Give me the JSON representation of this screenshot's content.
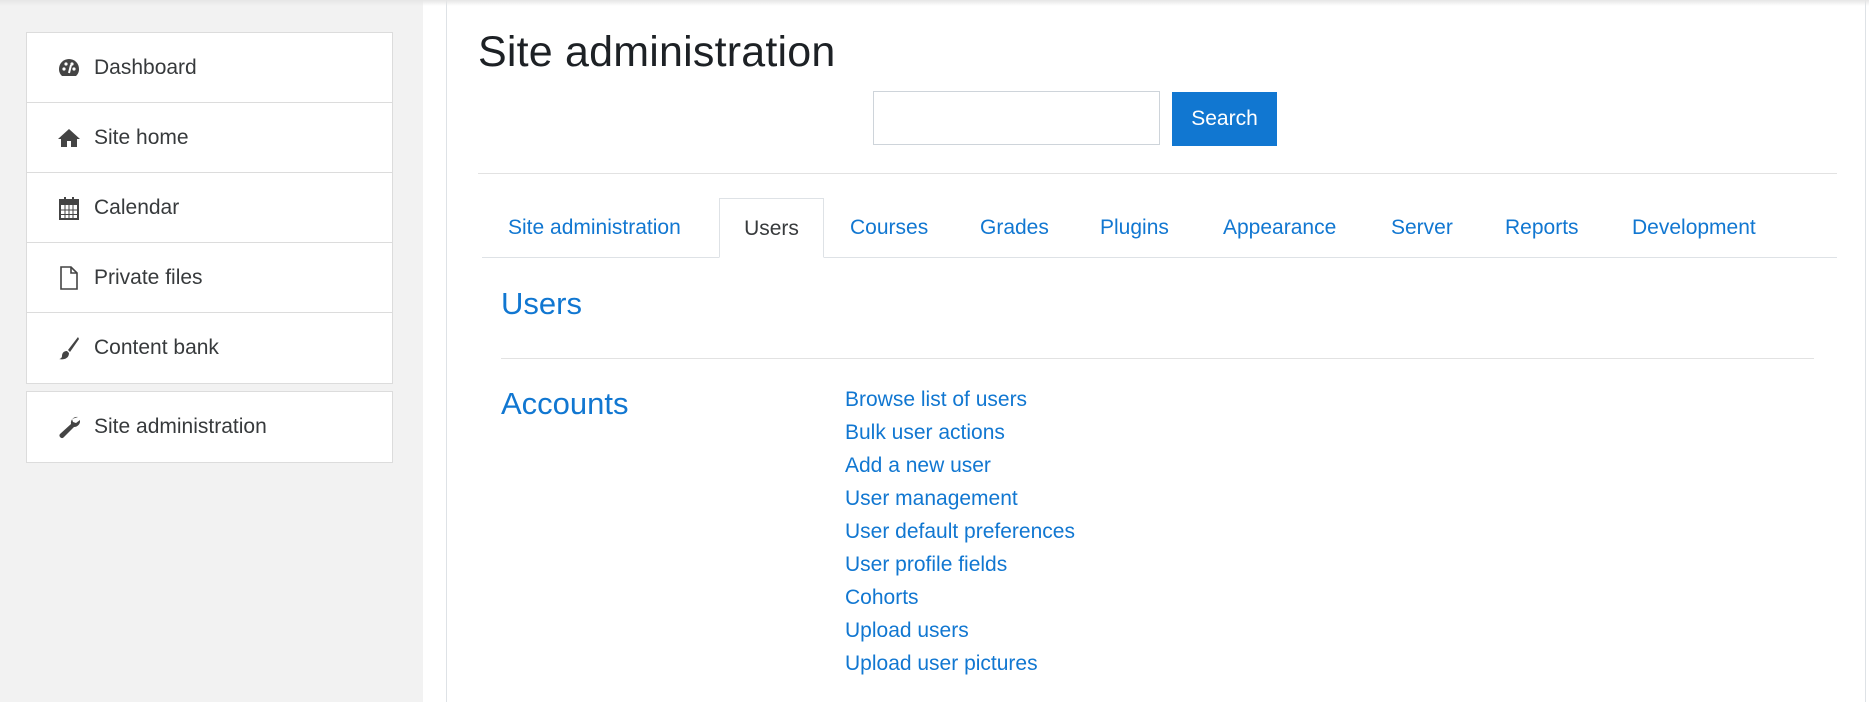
{
  "sidebar": {
    "items": [
      {
        "label": "Dashboard",
        "icon": "dashboard-icon"
      },
      {
        "label": "Site home",
        "icon": "home-icon"
      },
      {
        "label": "Calendar",
        "icon": "calendar-icon"
      },
      {
        "label": "Private files",
        "icon": "file-icon"
      },
      {
        "label": "Content bank",
        "icon": "paintbrush-icon"
      }
    ],
    "admin_item": {
      "label": "Site administration",
      "icon": "wrench-icon"
    }
  },
  "header": {
    "title": "Site administration",
    "search_value": "",
    "search_button": "Search"
  },
  "tabs": [
    {
      "label": "Site administration",
      "active": false
    },
    {
      "label": "Users",
      "active": true
    },
    {
      "label": "Courses",
      "active": false
    },
    {
      "label": "Grades",
      "active": false
    },
    {
      "label": "Plugins",
      "active": false
    },
    {
      "label": "Appearance",
      "active": false
    },
    {
      "label": "Server",
      "active": false
    },
    {
      "label": "Reports",
      "active": false
    },
    {
      "label": "Development",
      "active": false
    }
  ],
  "content": {
    "section_title": "Users",
    "category_title": "Accounts",
    "links": [
      "Browse list of users",
      "Bulk user actions",
      "Add a new user",
      "User management",
      "User default preferences",
      "User profile fields",
      "Cohorts",
      "Upload users",
      "Upload user pictures"
    ]
  },
  "colors": {
    "accent": "#1177d1",
    "text": "#373a3c",
    "sidebar_bg": "#f2f2f2"
  }
}
